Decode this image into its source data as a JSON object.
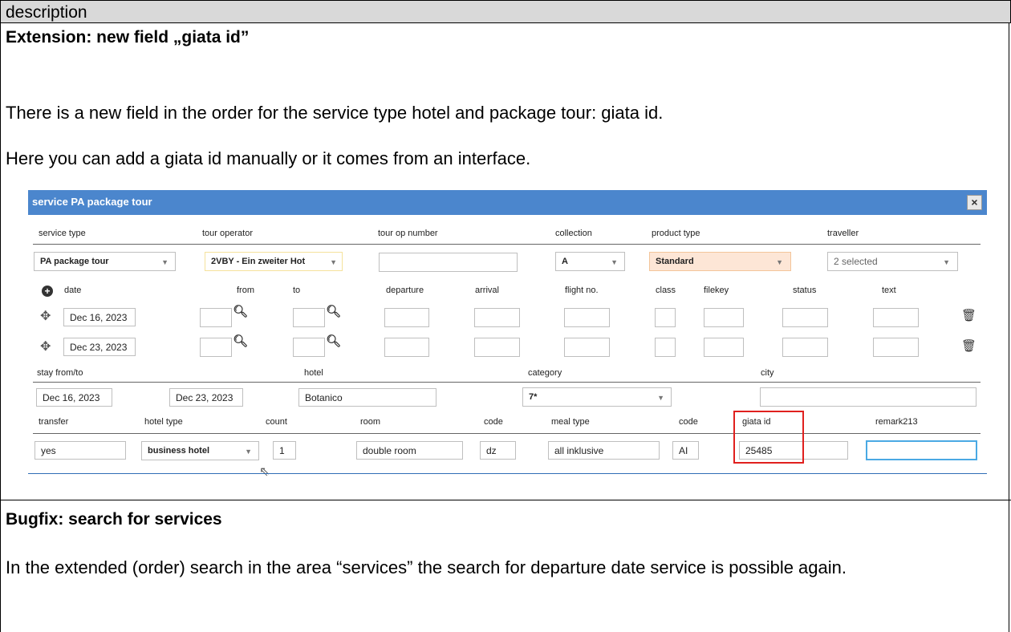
{
  "doc": {
    "header": "description",
    "extension_heading": "Extension: new field „giata id”",
    "p1": "There is a new field in the order for the service type hotel and package tour: giata id.",
    "p2": "Here you can add a giata id manually or it comes from an interface.",
    "bugfix_heading": "Bugfix: search for services",
    "p3": "In the extended (order) search in the area “services” the search for departure date service is possible again."
  },
  "dialog": {
    "title": "service PA package tour",
    "close_glyph": "×",
    "row1_labels": {
      "service_type": "service type",
      "tour_operator": "tour operator",
      "tour_op_number": "tour op number",
      "collection": "collection",
      "product_type": "product type",
      "traveller": "traveller"
    },
    "row1_values": {
      "service_type": "PA package tour",
      "tour_operator": "2VBY - Ein zweiter Hot",
      "tour_op_number": "",
      "collection": "A",
      "product_type": "Standard",
      "traveller": "2 selected"
    },
    "seg_labels": {
      "date": "date",
      "from": "from",
      "to": "to",
      "departure": "departure",
      "arrival": "arrival",
      "flight_no": "flight no.",
      "class": "class",
      "filekey": "filekey",
      "status": "status",
      "text": "text"
    },
    "segments": [
      {
        "date": "Dec 16, 2023"
      },
      {
        "date": "Dec 23, 2023"
      }
    ],
    "stay_labels": {
      "stay": "stay from/to",
      "hotel": "hotel",
      "category": "category",
      "city": "city"
    },
    "stay_values": {
      "from": "Dec 16, 2023",
      "to": "Dec 23, 2023",
      "hotel": "Botanico",
      "category": "7*",
      "city": ""
    },
    "hotel_labels": {
      "transfer": "transfer",
      "hotel_type": "hotel type",
      "count": "count",
      "room": "room",
      "code": "code",
      "meal_type": "meal type",
      "code2": "code",
      "giata_id": "giata id",
      "remark": "remark213"
    },
    "hotel_values": {
      "transfer": "yes",
      "hotel_type": "business hotel",
      "count": "1",
      "room": "double room",
      "code": "dz",
      "meal_type": "all inklusive",
      "code2": "AI",
      "giata_id": "25485",
      "remark": ""
    },
    "icons": {
      "add": "plus-circle-icon",
      "move": "move-icon",
      "search": "search-icon",
      "delete": "trash-icon",
      "dropdown": "chevron-down-icon"
    },
    "colors": {
      "titlebar": "#4b86cd",
      "highlight": "#e0201e",
      "product_type_bg": "#fde6d6"
    }
  }
}
